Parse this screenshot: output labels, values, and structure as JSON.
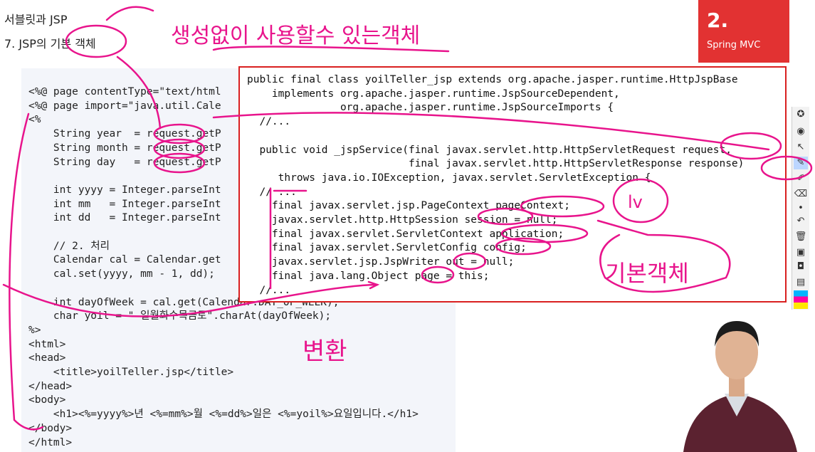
{
  "header": {
    "title": "서블릿과 JSP",
    "subtitle": "7. JSP의 기본 객체"
  },
  "badge": {
    "number": "2.",
    "label": "Spring MVC"
  },
  "left_code": {
    "lines": [
      "<%@ page contentType=\"text/html",
      "<%@ page import=\"java.util.Cale",
      "<%",
      "    String year  = request.getP",
      "    String month = request.getP",
      "    String day   = request.getP",
      "",
      "    int yyyy = Integer.parseInt",
      "    int mm   = Integer.parseInt",
      "    int dd   = Integer.parseInt",
      "",
      "    // 2. 처리",
      "    Calendar cal = Calendar.get",
      "    cal.set(yyyy, mm - 1, dd);",
      "",
      "    int dayOfWeek = cal.get(Calendar.DAY_OF_WEEK);",
      "    char yoil = \" 일월화수목금토\".charAt(dayOfWeek);",
      "%>",
      "<html>",
      "<head>",
      "    <title>yoilTeller.jsp</title>",
      "</head>",
      "<body>",
      "    <h1><%=yyyy%>년 <%=mm%>월 <%=dd%>일은 <%=yoil%>요일입니다.</h1>",
      "</body>",
      "</html>"
    ]
  },
  "right_code": {
    "lines": [
      "public final class yoilTeller_jsp extends org.apache.jasper.runtime.HttpJspBase",
      "    implements org.apache.jasper.runtime.JspSourceDependent,",
      "               org.apache.jasper.runtime.JspSourceImports {",
      "  //...",
      "",
      "  public void _jspService(final javax.servlet.http.HttpServletRequest request,",
      "                          final javax.servlet.http.HttpServletResponse response)",
      "     throws java.io.IOException, javax.servlet.ServletException {",
      "  // ...",
      "    final javax.servlet.jsp.PageContext pageContext;",
      "    javax.servlet.http.HttpSession session = null;",
      "    final javax.servlet.ServletContext application;",
      "    final javax.servlet.ServletConfig config;",
      "    javax.servlet.jsp.JspWriter out = null;",
      "    final java.lang.Object page = this;",
      "  //..."
    ]
  },
  "annotations": {
    "top": "생성없이 사용할수 있는객체",
    "basic_objects": "기본객체",
    "convert": "변환",
    "lv": "lv",
    "colors": {
      "ink": "#e8148c",
      "border": "#d92020",
      "badge": "#e23232"
    }
  },
  "sidebar": {
    "icons": [
      "lightbulb-icon",
      "eye-icon",
      "cursor-icon",
      "pen-icon",
      "highlighter-icon",
      "eraser-icon",
      "dot-icon",
      "undo-icon",
      "trash-icon",
      "screen-icon",
      "camera-icon",
      "clipboard-icon",
      "palette-icon"
    ]
  }
}
